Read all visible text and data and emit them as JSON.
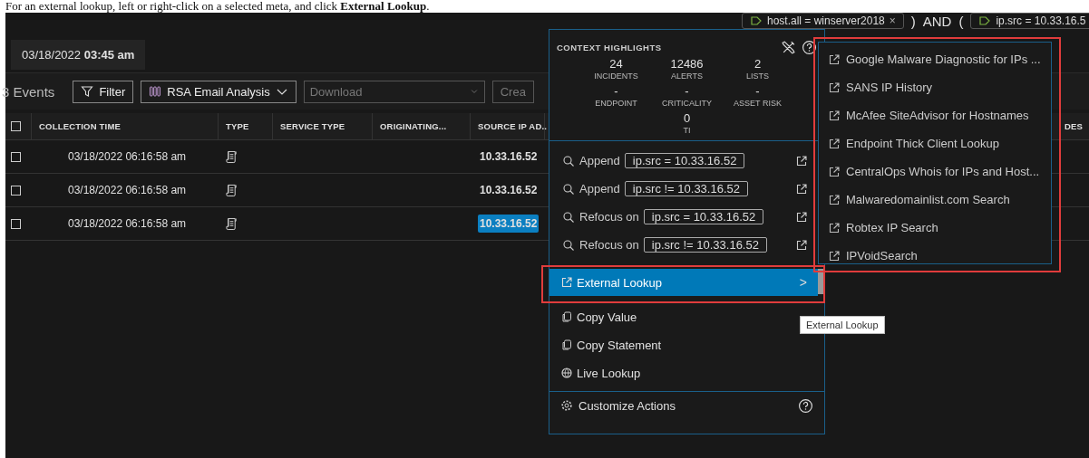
{
  "caption": "For an external lookup, left or right-click on a selected meta, and click **External Lookup**.",
  "query_tokens": [
    {
      "kind": "pill",
      "text": "host.all = winserver2018",
      "close": "×"
    },
    {
      "kind": "text",
      "text": ")"
    },
    {
      "kind": "text",
      "text": "AND"
    },
    {
      "kind": "text",
      "text": "("
    },
    {
      "kind": "pill",
      "text": "ip.src = 10.33.16.5"
    }
  ],
  "date_range": "03/18/2022 **03:45 am**",
  "toolbar": {
    "events": "3 Events",
    "filter": "Filter",
    "profile": "RSA Email Analysis",
    "download_placeholder": "Download",
    "create": "Crea"
  },
  "table": {
    "all_checked": false,
    "columns": [
      "COLLECTION TIME",
      "TYPE",
      "SERVICE TYPE",
      "ORIGINATING...",
      "SOURCE IP AD..",
      "DES"
    ],
    "rows": [
      {
        "checked": false,
        "time": "03/18/2022 06:16:58 am",
        "ip": "10.33.16.52",
        "selected": false
      },
      {
        "checked": false,
        "time": "03/18/2022 06:16:58 am",
        "ip": "10.33.16.52",
        "selected": false
      },
      {
        "checked": false,
        "time": "03/18/2022 06:16:58 am",
        "ip": "10.33.16.52",
        "selected": true
      }
    ]
  },
  "context": {
    "title": "CONTEXT HIGHLIGHTS",
    "stats": [
      {
        "value": "24",
        "label": "INCIDENTS"
      },
      {
        "value": "12486",
        "label": "ALERTS"
      },
      {
        "value": "2",
        "label": "LISTS"
      },
      {
        "value": "-",
        "label": "ENDPOINT"
      },
      {
        "value": "-",
        "label": "CRITICALITY"
      },
      {
        "value": "-",
        "label": "ASSET RISK"
      },
      {
        "value": "0",
        "label": "TI"
      }
    ],
    "actions": [
      {
        "verb": "Append",
        "query": "ip.src = 10.33.16.52"
      },
      {
        "verb": "Append",
        "query": "ip.src != 10.33.16.52"
      },
      {
        "verb": "Refocus on",
        "query": "ip.src = 10.33.16.52"
      },
      {
        "verb": "Refocus on",
        "query": "ip.src != 10.33.16.52"
      }
    ],
    "menu": [
      {
        "kind": "external",
        "label": "External Lookup",
        "selected": true,
        "highlighted": true,
        "arrow": ">"
      },
      {
        "kind": "copy",
        "label": "Copy Value",
        "selected": false,
        "highlighted": false
      },
      {
        "kind": "copy",
        "label": "Copy Statement",
        "selected": false,
        "highlighted": false
      },
      {
        "kind": "live",
        "label": "Live Lookup",
        "selected": false,
        "highlighted": false
      }
    ],
    "footer": "Customize Actions"
  },
  "tooltip": "External Lookup",
  "external_lookup": {
    "highlighted": true,
    "items": [
      "Google Malware Diagnostic for IPs ...",
      "SANS IP History",
      "McAfee SiteAdvisor for Hostnames",
      "Endpoint Thick Client Lookup",
      "CentralOps Whois for IPs and Host...",
      "Malwaredomainlist.com Search",
      "Robtex IP Search",
      "IPVoidSearch"
    ]
  }
}
